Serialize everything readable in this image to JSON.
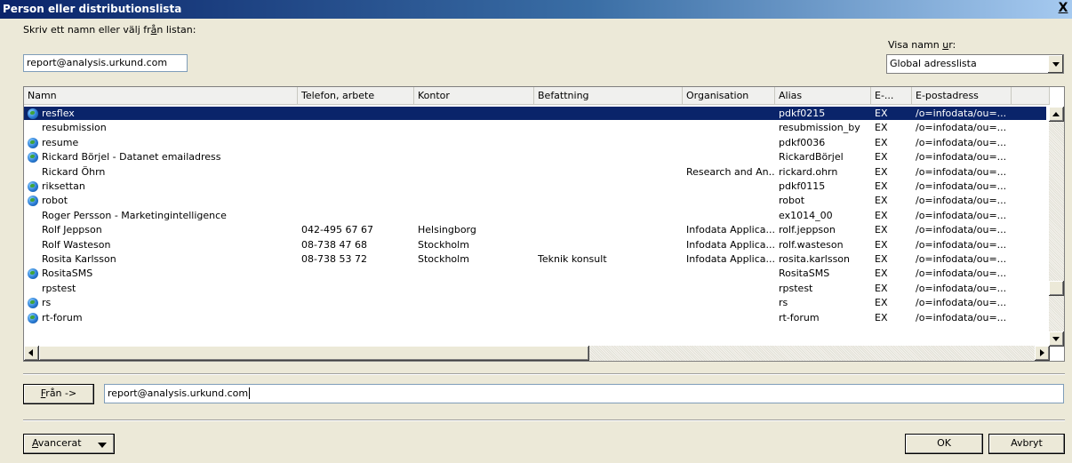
{
  "window": {
    "title": "Person eller distributionslista",
    "close_label": "X"
  },
  "search": {
    "label_prefix": "Skriv ett namn eller välj fr",
    "label_hot": "å",
    "label_suffix": "n listan:",
    "value": "report@analysis.urkund.com"
  },
  "addressbook": {
    "label_prefix": "Visa namn ",
    "label_hot": "u",
    "label_suffix": "r:",
    "selected": "Global adresslista"
  },
  "columns": [
    "Namn",
    "Telefon, arbete",
    "Kontor",
    "Befattning",
    "Organisation",
    "Alias",
    "E-...",
    "E-postadress"
  ],
  "rows": [
    {
      "name": "resflex",
      "phone": "",
      "office": "",
      "title": "",
      "org": "",
      "alias": "pdkf0215",
      "type": "EX",
      "email": "/o=infodata/ou=...",
      "icon": "globe-icon",
      "selected": true
    },
    {
      "name": "resubmission",
      "phone": "",
      "office": "",
      "title": "",
      "org": "",
      "alias": "resubmission_by",
      "type": "EX",
      "email": "/o=infodata/ou=...",
      "icon": ""
    },
    {
      "name": "resume",
      "phone": "",
      "office": "",
      "title": "",
      "org": "",
      "alias": "pdkf0036",
      "type": "EX",
      "email": "/o=infodata/ou=...",
      "icon": "globe-icon"
    },
    {
      "name": "Rickard Börjel - Datanet emailadress",
      "phone": "",
      "office": "",
      "title": "",
      "org": "",
      "alias": "RickardBörjel",
      "type": "EX",
      "email": "/o=infodata/ou=...",
      "icon": "globe-icon"
    },
    {
      "name": "Rickard Öhrn",
      "phone": "",
      "office": "",
      "title": "",
      "org": "Research and An...",
      "alias": "rickard.ohrn",
      "type": "EX",
      "email": "/o=infodata/ou=...",
      "icon": ""
    },
    {
      "name": "riksettan",
      "phone": "",
      "office": "",
      "title": "",
      "org": "",
      "alias": "pdkf0115",
      "type": "EX",
      "email": "/o=infodata/ou=...",
      "icon": "globe-icon"
    },
    {
      "name": "robot",
      "phone": "",
      "office": "",
      "title": "",
      "org": "",
      "alias": "robot",
      "type": "EX",
      "email": "/o=infodata/ou=...",
      "icon": "globe-icon"
    },
    {
      "name": "Roger Persson - Marketingintelligence",
      "phone": "",
      "office": "",
      "title": "",
      "org": "",
      "alias": "ex1014_00",
      "type": "EX",
      "email": "/o=infodata/ou=...",
      "icon": ""
    },
    {
      "name": "Rolf Jeppson",
      "phone": "042-495 67 67",
      "office": "Helsingborg",
      "title": "",
      "org": "Infodata Applica...",
      "alias": "rolf.jeppson",
      "type": "EX",
      "email": "/o=infodata/ou=...",
      "icon": ""
    },
    {
      "name": "Rolf Wasteson",
      "phone": "08-738 47 68",
      "office": "Stockholm",
      "title": "",
      "org": "Infodata Applica...",
      "alias": "rolf.wasteson",
      "type": "EX",
      "email": "/o=infodata/ou=...",
      "icon": ""
    },
    {
      "name": "Rosita Karlsson",
      "phone": "08-738 53 72",
      "office": "Stockholm",
      "title": "Teknik konsult",
      "org": "Infodata Applica...",
      "alias": "rosita.karlsson",
      "type": "EX",
      "email": "/o=infodata/ou=...",
      "icon": ""
    },
    {
      "name": "RositaSMS",
      "phone": "",
      "office": "",
      "title": "",
      "org": "",
      "alias": "RositaSMS",
      "type": "EX",
      "email": "/o=infodata/ou=...",
      "icon": "globe-icon"
    },
    {
      "name": "rpstest",
      "phone": "",
      "office": "",
      "title": "",
      "org": "",
      "alias": "rpstest",
      "type": "EX",
      "email": "/o=infodata/ou=...",
      "icon": ""
    },
    {
      "name": "rs",
      "phone": "",
      "office": "",
      "title": "",
      "org": "",
      "alias": "rs",
      "type": "EX",
      "email": "/o=infodata/ou=...",
      "icon": "globe-icon"
    },
    {
      "name": "rt-forum",
      "phone": "",
      "office": "",
      "title": "",
      "org": "",
      "alias": "rt-forum",
      "type": "EX",
      "email": "/o=infodata/ou=...",
      "icon": "globe-icon"
    }
  ],
  "from": {
    "button_hot": "F",
    "button_rest": "rån ->",
    "value": "report@analysis.urkund.com"
  },
  "advanced": {
    "hot": "A",
    "rest": "vancerat"
  },
  "ok_label": "OK",
  "cancel_label": "Avbryt",
  "colors": {
    "selection": "#0a246a",
    "face": "#ece9d8"
  }
}
